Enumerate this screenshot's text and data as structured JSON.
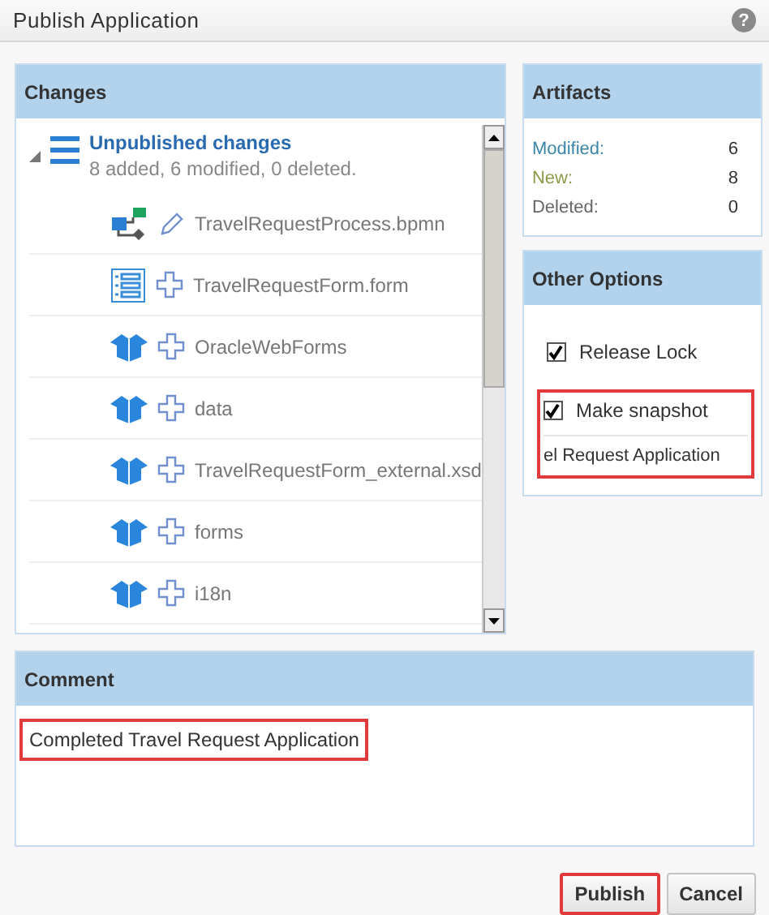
{
  "window": {
    "title": "Publish Application",
    "help": "?"
  },
  "changes": {
    "title": "Changes",
    "group": {
      "title": "Unpublished changes",
      "summary": "8 added, 6 modified, 0 deleted.",
      "expanded": true,
      "children": [
        {
          "name": "TravelRequestProcess.bpmn",
          "kind": "process",
          "modified": true
        },
        {
          "name": "TravelRequestForm.form",
          "kind": "form",
          "modified": false
        },
        {
          "name": "OracleWebForms",
          "kind": "package",
          "modified": false
        },
        {
          "name": "data",
          "kind": "package",
          "modified": false
        },
        {
          "name": "TravelRequestForm_external.xsd",
          "kind": "package",
          "modified": false
        },
        {
          "name": "forms",
          "kind": "package",
          "modified": false
        },
        {
          "name": "i18n",
          "kind": "package",
          "modified": false
        }
      ]
    }
  },
  "artifacts": {
    "title": "Artifacts",
    "rows": [
      {
        "label": "Modified:",
        "value": "6",
        "kind": "modified"
      },
      {
        "label": "New:",
        "value": "8",
        "kind": "new"
      },
      {
        "label": "Deleted:",
        "value": "0",
        "kind": "deleted"
      }
    ]
  },
  "options": {
    "title": "Other Options",
    "items": [
      {
        "label": "Release Lock",
        "checked": true,
        "highlighted": false
      },
      {
        "label": "Make snapshot",
        "checked": true,
        "highlighted": true,
        "value": "el Request Application"
      }
    ]
  },
  "comment": {
    "title": "Comment",
    "value": "Completed Travel Request Application",
    "highlighted": true
  },
  "buttons": [
    {
      "label": "Publish",
      "highlighted": true
    },
    {
      "label": "Cancel",
      "highlighted": false
    }
  ]
}
